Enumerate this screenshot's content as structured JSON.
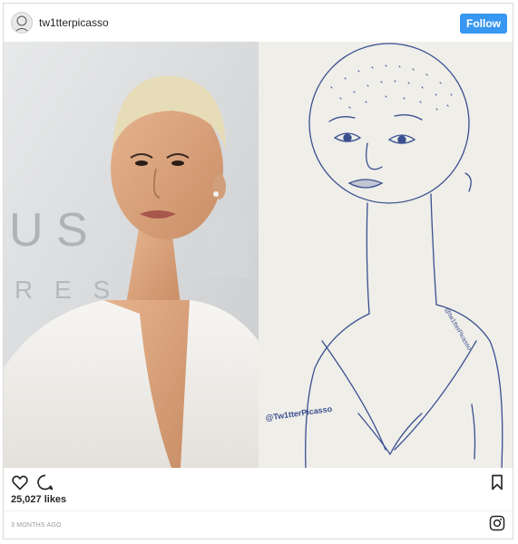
{
  "header": {
    "username": "tw1tterpicasso",
    "follow_label": "Follow"
  },
  "media": {
    "backdrop_letters_top": "U S",
    "backdrop_letters_bottom": "R E S",
    "sketch_watermark": "@Tw1tterPicasso",
    "sketch_signature": "@tw1tterPicasso"
  },
  "actions": {
    "like_icon": "heart-icon",
    "comment_icon": "comment-icon",
    "save_icon": "bookmark-icon"
  },
  "likes": "25,027 likes",
  "timestamp": "3 MONTHS AGO",
  "footer_icon": "instagram-icon",
  "colors": {
    "follow_button": "#3897f0",
    "sketch_ink": "#3a4f8f"
  }
}
